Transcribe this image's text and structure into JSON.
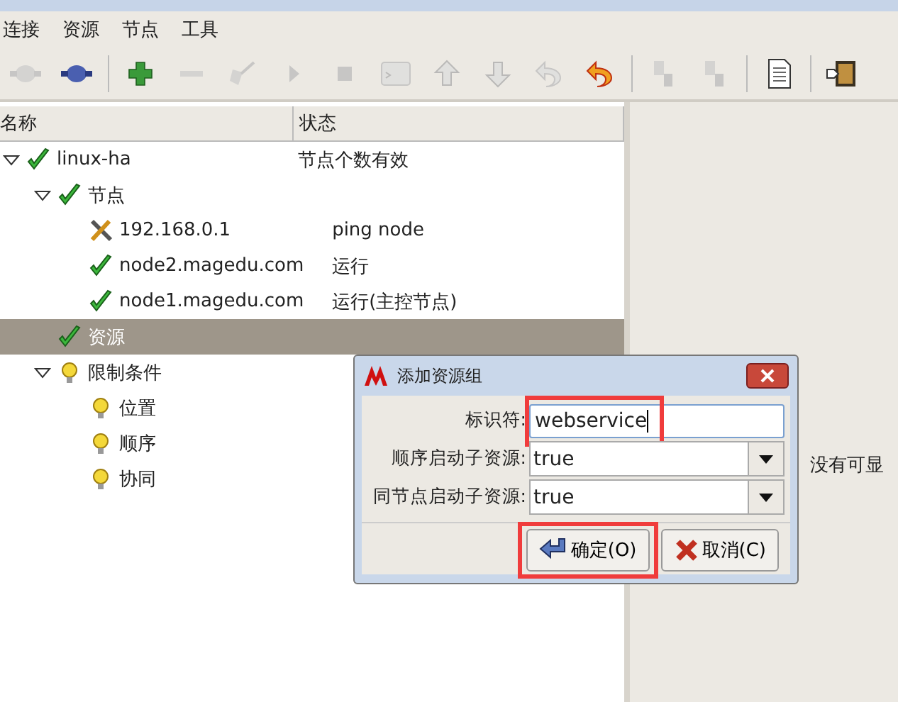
{
  "menu": [
    "连接",
    "资源",
    "节点",
    "工具"
  ],
  "toolbar": [
    {
      "kind": "plug",
      "disabled": true
    },
    {
      "kind": "plug",
      "disabled": false
    },
    {
      "kind": "separator"
    },
    {
      "kind": "plus",
      "disabled": false
    },
    {
      "kind": "minus",
      "disabled": true
    },
    {
      "kind": "broom",
      "disabled": true
    },
    {
      "kind": "play",
      "disabled": true
    },
    {
      "kind": "stop",
      "disabled": true
    },
    {
      "kind": "terminal",
      "disabled": true
    },
    {
      "kind": "up",
      "disabled": true
    },
    {
      "kind": "down",
      "disabled": true
    },
    {
      "kind": "undo",
      "disabled": true
    },
    {
      "kind": "undo",
      "disabled": false
    },
    {
      "kind": "separator"
    },
    {
      "kind": "node",
      "disabled": true
    },
    {
      "kind": "node",
      "disabled": true
    },
    {
      "kind": "separator"
    },
    {
      "kind": "document",
      "disabled": false
    },
    {
      "kind": "separator"
    },
    {
      "kind": "exit",
      "disabled": false
    }
  ],
  "tree": {
    "columns": [
      "名称",
      "状态"
    ],
    "items": [
      {
        "name": "linux-ha",
        "status": "节点个数有效",
        "kind": "check",
        "expanded": true,
        "selected": false,
        "children": [
          {
            "name": "节点",
            "kind": "check",
            "expanded": true,
            "selected": false,
            "children": [
              {
                "name": "192.168.0.1",
                "status": "ping node",
                "kind": "wrench",
                "selected": false
              },
              {
                "name": "node2.magedu.com",
                "status": "运行",
                "kind": "check",
                "selected": false
              },
              {
                "name": "node1.magedu.com",
                "status": "运行(主控节点)",
                "kind": "check",
                "selected": false
              }
            ]
          },
          {
            "name": "资源",
            "kind": "check",
            "selected": true
          },
          {
            "name": "限制条件",
            "kind": "bulb",
            "expanded": true,
            "selected": false,
            "children": [
              {
                "name": "位置",
                "kind": "bulb",
                "selected": false
              },
              {
                "name": "顺序",
                "kind": "bulb",
                "selected": false
              },
              {
                "name": "协同",
                "kind": "bulb",
                "selected": false
              }
            ]
          }
        ]
      }
    ]
  },
  "right_panel": {
    "message": "没有可显"
  },
  "dialog": {
    "title": "添加资源组",
    "fields": [
      {
        "label": "标识符:",
        "kind": "text",
        "value": "webservice",
        "highlighted": true
      },
      {
        "label": "顺序启动子资源:",
        "kind": "select",
        "value": "true",
        "highlighted": false
      },
      {
        "label": "同节点启动子资源:",
        "kind": "select",
        "value": "true",
        "highlighted": false
      }
    ],
    "buttons": [
      {
        "label": "确定(O)",
        "kind": "ok",
        "highlighted": true
      },
      {
        "label": "取消(C)",
        "kind": "cancel",
        "highlighted": false
      }
    ]
  }
}
